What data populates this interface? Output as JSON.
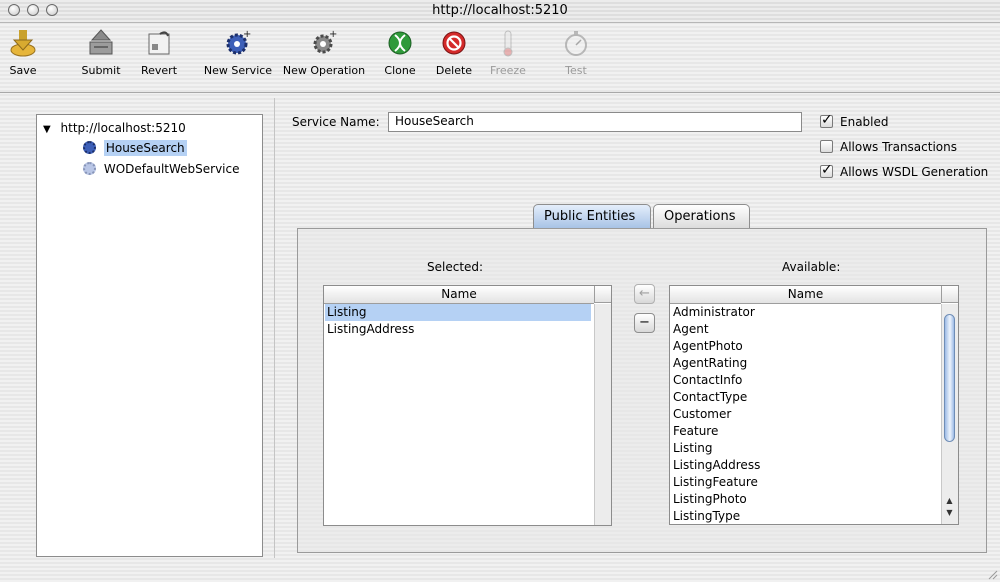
{
  "window": {
    "title": "http://localhost:5210"
  },
  "toolbar": [
    {
      "label": "Save",
      "icon": "save-icon",
      "enabled": true
    },
    {
      "label": "Submit",
      "icon": "submit-icon",
      "enabled": true
    },
    {
      "label": "Revert",
      "icon": "revert-icon",
      "enabled": true
    },
    {
      "label": "New Service",
      "icon": "new-service-gear-icon",
      "enabled": true
    },
    {
      "label": "New Operation",
      "icon": "new-operation-gear-icon",
      "enabled": true
    },
    {
      "label": "Clone",
      "icon": "clone-dna-icon",
      "enabled": true
    },
    {
      "label": "Delete",
      "icon": "delete-icon",
      "enabled": true
    },
    {
      "label": "Freeze",
      "icon": "freeze-thermometer-icon",
      "enabled": false
    },
    {
      "label": "Test",
      "icon": "stopwatch-icon",
      "enabled": false
    }
  ],
  "tree": {
    "root": "http://localhost:5210",
    "items": [
      {
        "label": "HouseSearch",
        "selected": true
      },
      {
        "label": "WODefaultWebService",
        "selected": false
      }
    ]
  },
  "service": {
    "name_label": "Service Name:",
    "name_value": "HouseSearch",
    "enabled_label": "Enabled",
    "enabled": true,
    "transactions_label": "Allows Transactions",
    "transactions": false,
    "wsdl_label": "Allows WSDL Generation",
    "wsdl": true
  },
  "tabs": [
    {
      "label": "Public Entities",
      "active": true
    },
    {
      "label": "Operations",
      "active": false
    }
  ],
  "selected_table": {
    "caption": "Selected:",
    "header": "Name",
    "rows": [
      "Listing",
      "ListingAddress"
    ],
    "selected_row": "Listing"
  },
  "available_table": {
    "caption": "Available:",
    "header": "Name",
    "rows": [
      "Administrator",
      "Agent",
      "AgentPhoto",
      "AgentRating",
      "ContactInfo",
      "ContactType",
      "Customer",
      "Feature",
      "Listing",
      "ListingAddress",
      "ListingFeature",
      "ListingPhoto",
      "ListingType"
    ]
  },
  "move_buttons": {
    "add_symbol": "←",
    "remove_symbol": "−"
  },
  "colors": {
    "selection": "#b5d1f4",
    "tab_active": "#a8c3e6"
  }
}
